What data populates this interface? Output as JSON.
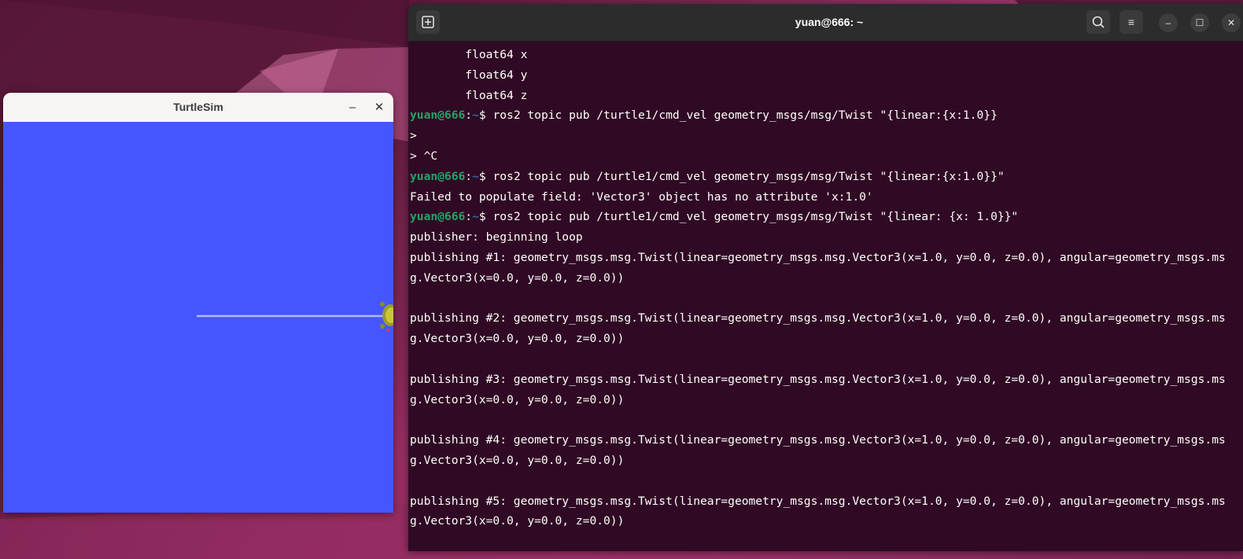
{
  "colors": {
    "turtle_canvas": "#4556ff",
    "terminal_bg": "#300a24",
    "prompt_user": "#26a269",
    "prompt_path": "#3465a4",
    "header_bg": "#2c2c2c"
  },
  "turtlesim": {
    "title": "TurtleSim",
    "minimize_icon": "–",
    "close_icon": "✕"
  },
  "terminal": {
    "title": "yuan@666: ~",
    "new_tab_icon": "+",
    "search_icon": "search-icon",
    "menu_icon": "≡",
    "minimize_icon": "–",
    "maximize_icon": "☐",
    "close_icon": "✕",
    "prompt": {
      "user": "yuan@666",
      "sep": ":",
      "path": "~",
      "dollar": "$ "
    },
    "lines": [
      {
        "type": "text",
        "text": "        float64 x"
      },
      {
        "type": "text",
        "text": "        float64 y"
      },
      {
        "type": "text",
        "text": "        float64 z"
      },
      {
        "type": "prompt",
        "text": "ros2 topic pub /turtle1/cmd_vel geometry_msgs/msg/Twist \"{linear:{x:1.0}}"
      },
      {
        "type": "text",
        "text": ">"
      },
      {
        "type": "text",
        "text": "> ^C"
      },
      {
        "type": "prompt",
        "text": "ros2 topic pub /turtle1/cmd_vel geometry_msgs/msg/Twist \"{linear:{x:1.0}}\""
      },
      {
        "type": "text",
        "text": "Failed to populate field: 'Vector3' object has no attribute 'x:1.0'"
      },
      {
        "type": "prompt",
        "text": "ros2 topic pub /turtle1/cmd_vel geometry_msgs/msg/Twist \"{linear: {x: 1.0}}\""
      },
      {
        "type": "text",
        "text": "publisher: beginning loop"
      },
      {
        "type": "text",
        "text": "publishing #1: geometry_msgs.msg.Twist(linear=geometry_msgs.msg.Vector3(x=1.0, y=0.0, z=0.0), angular=geometry_msgs.ms"
      },
      {
        "type": "text",
        "text": "g.Vector3(x=0.0, y=0.0, z=0.0))"
      },
      {
        "type": "text",
        "text": ""
      },
      {
        "type": "text",
        "text": "publishing #2: geometry_msgs.msg.Twist(linear=geometry_msgs.msg.Vector3(x=1.0, y=0.0, z=0.0), angular=geometry_msgs.ms"
      },
      {
        "type": "text",
        "text": "g.Vector3(x=0.0, y=0.0, z=0.0))"
      },
      {
        "type": "text",
        "text": ""
      },
      {
        "type": "text",
        "text": "publishing #3: geometry_msgs.msg.Twist(linear=geometry_msgs.msg.Vector3(x=1.0, y=0.0, z=0.0), angular=geometry_msgs.ms"
      },
      {
        "type": "text",
        "text": "g.Vector3(x=0.0, y=0.0, z=0.0))"
      },
      {
        "type": "text",
        "text": ""
      },
      {
        "type": "text",
        "text": "publishing #4: geometry_msgs.msg.Twist(linear=geometry_msgs.msg.Vector3(x=1.0, y=0.0, z=0.0), angular=geometry_msgs.ms"
      },
      {
        "type": "text",
        "text": "g.Vector3(x=0.0, y=0.0, z=0.0))"
      },
      {
        "type": "text",
        "text": ""
      },
      {
        "type": "text",
        "text": "publishing #5: geometry_msgs.msg.Twist(linear=geometry_msgs.msg.Vector3(x=1.0, y=0.0, z=0.0), angular=geometry_msgs.ms"
      },
      {
        "type": "text",
        "text": "g.Vector3(x=0.0, y=0.0, z=0.0))"
      }
    ]
  }
}
